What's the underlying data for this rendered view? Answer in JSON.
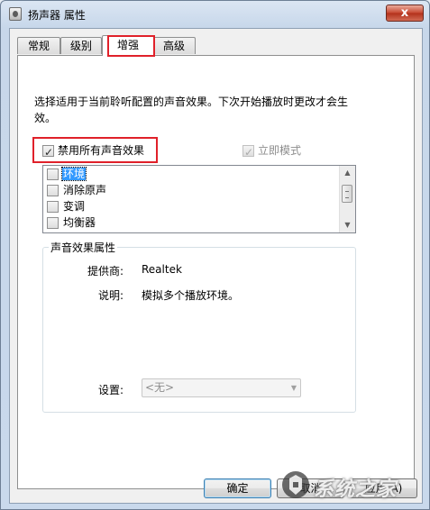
{
  "window": {
    "title": "扬声器 属性",
    "close_label": "x"
  },
  "tabs": [
    {
      "label": "常规"
    },
    {
      "label": "级别"
    },
    {
      "label": "增强"
    },
    {
      "label": "高级"
    }
  ],
  "enhancements": {
    "description": "选择适用于当前聆听配置的声音效果。下次开始播放时更改才会生效。",
    "disable_all_label": "禁用所有声音效果",
    "disable_all_checked": true,
    "immediate_mode_label": "立即模式",
    "immediate_mode_checked": true,
    "effects": [
      {
        "label": "环境",
        "checked": false,
        "selected": true
      },
      {
        "label": "消除原声",
        "checked": false,
        "selected": false
      },
      {
        "label": "变调",
        "checked": false,
        "selected": false
      },
      {
        "label": "均衡器",
        "checked": false,
        "selected": false
      }
    ]
  },
  "properties": {
    "group_title": "声音效果属性",
    "provider_label": "提供商:",
    "provider_value": "Realtek",
    "description_label": "说明:",
    "description_value": "模拟多个播放环境。",
    "settings_label": "设置:",
    "settings_value": "<无>"
  },
  "buttons": {
    "ok": "确定",
    "cancel": "取消",
    "apply": "应用(A)"
  },
  "watermark": {
    "text": "系统之家"
  },
  "colors": {
    "highlight_red": "#e0212a",
    "selection_blue": "#3399ff"
  }
}
